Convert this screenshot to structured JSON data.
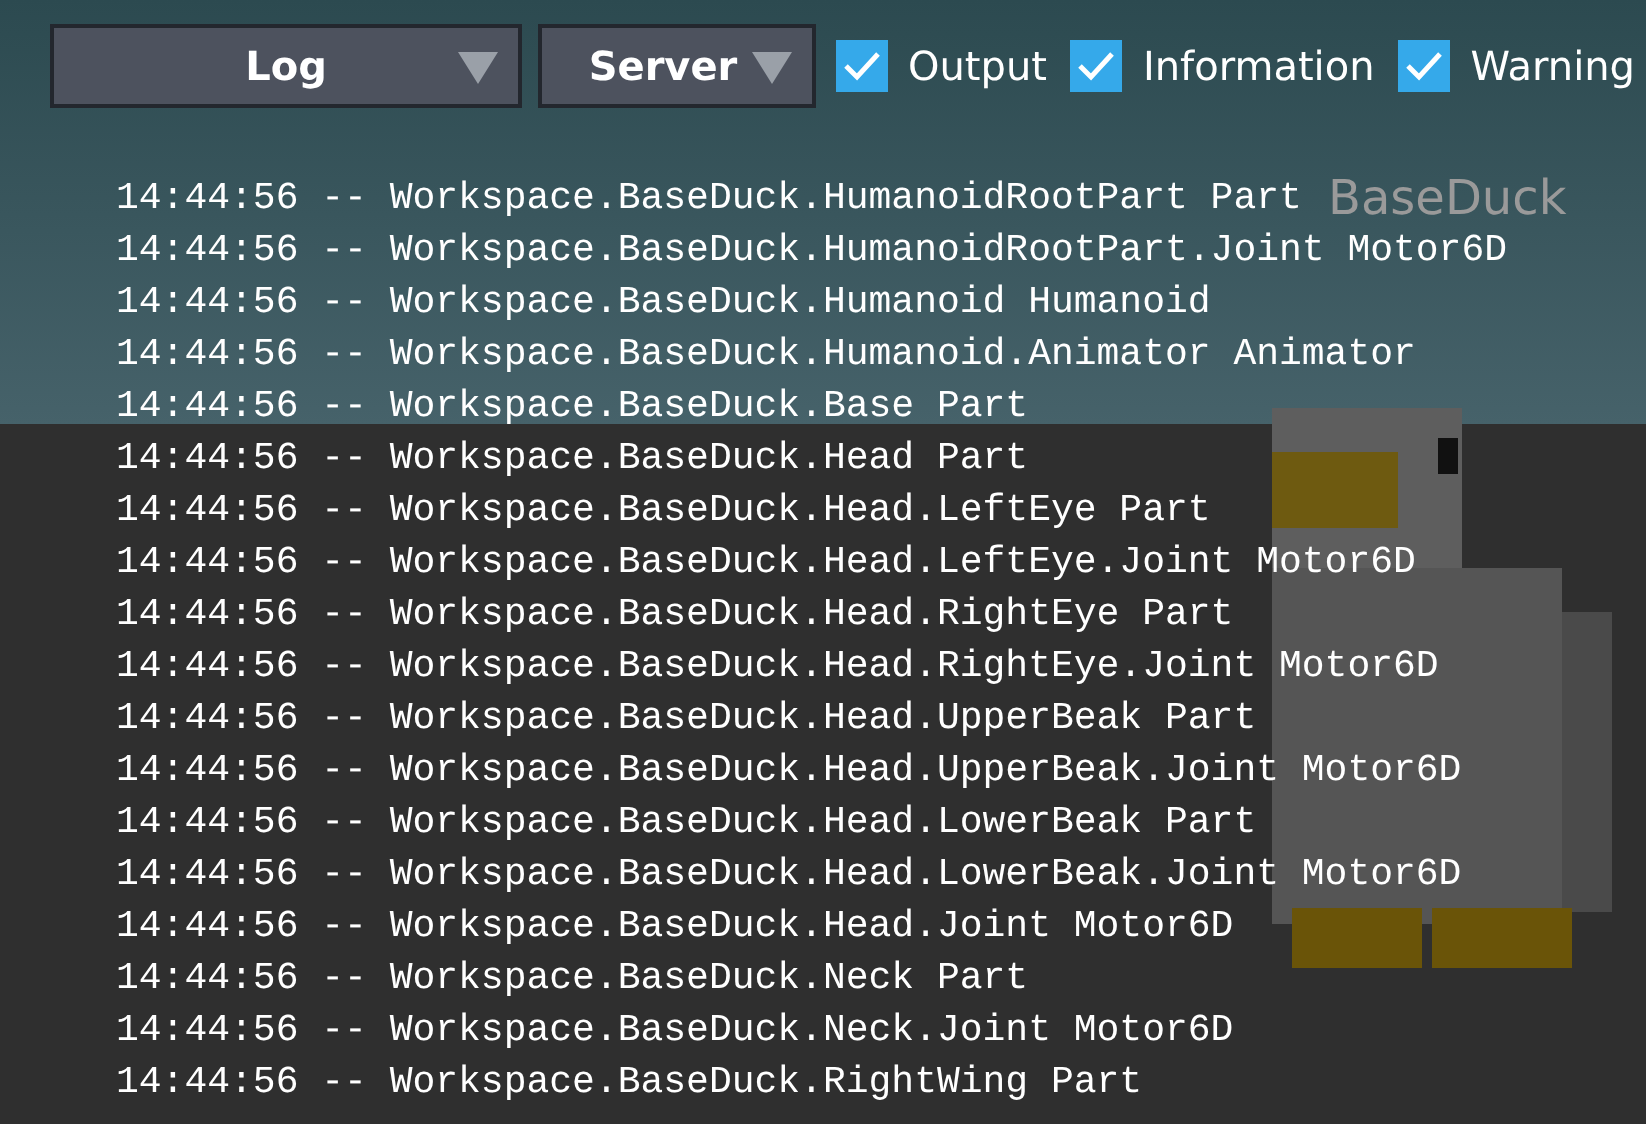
{
  "toolbar": {
    "dropdowns": [
      {
        "value": "Log"
      },
      {
        "value": "Server"
      }
    ],
    "filters": [
      {
        "label": "Output",
        "checked": true
      },
      {
        "label": "Information",
        "checked": true
      },
      {
        "label": "Warning",
        "checked": true
      }
    ]
  },
  "scene": {
    "name_tag": "BaseDuck"
  },
  "log": [
    {
      "text": "14:44:56 -- Workspace.BaseDuck.HumanoidRootPart Part"
    },
    {
      "text": "14:44:56 -- Workspace.BaseDuck.HumanoidRootPart.Joint Motor6D"
    },
    {
      "text": "14:44:56 -- Workspace.BaseDuck.Humanoid Humanoid"
    },
    {
      "text": "14:44:56 -- Workspace.BaseDuck.Humanoid.Animator Animator"
    },
    {
      "text": "14:44:56 -- Workspace.BaseDuck.Base Part"
    },
    {
      "text": "14:44:56 -- Workspace.BaseDuck.Head Part"
    },
    {
      "text": "14:44:56 -- Workspace.BaseDuck.Head.LeftEye Part"
    },
    {
      "text": "14:44:56 -- Workspace.BaseDuck.Head.LeftEye.Joint Motor6D"
    },
    {
      "text": "14:44:56 -- Workspace.BaseDuck.Head.RightEye Part"
    },
    {
      "text": "14:44:56 -- Workspace.BaseDuck.Head.RightEye.Joint Motor6D"
    },
    {
      "text": "14:44:56 -- Workspace.BaseDuck.Head.UpperBeak Part"
    },
    {
      "text": "14:44:56 -- Workspace.BaseDuck.Head.UpperBeak.Joint Motor6D"
    },
    {
      "text": "14:44:56 -- Workspace.BaseDuck.Head.LowerBeak Part"
    },
    {
      "text": "14:44:56 -- Workspace.BaseDuck.Head.LowerBeak.Joint Motor6D"
    },
    {
      "text": "14:44:56 -- Workspace.BaseDuck.Head.Joint Motor6D"
    },
    {
      "text": "14:44:56 -- Workspace.BaseDuck.Neck Part"
    },
    {
      "text": "14:44:56 -- Workspace.BaseDuck.Neck.Joint Motor6D"
    },
    {
      "text": "14:44:56 -- Workspace.BaseDuck.RightWing Part"
    }
  ]
}
